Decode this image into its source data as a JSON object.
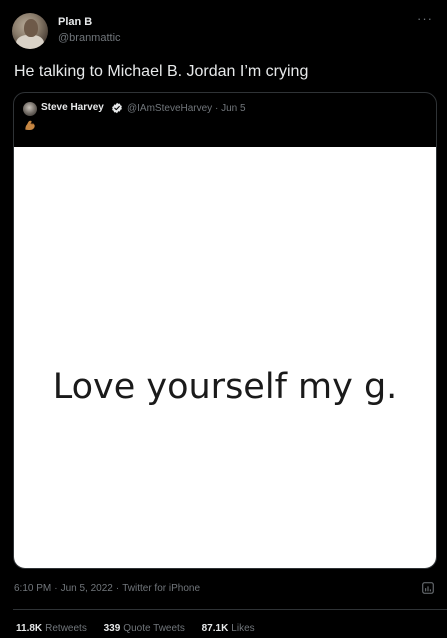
{
  "author": {
    "name": "Plan B",
    "handle": "@branmattic"
  },
  "tweet": {
    "text": "He talking to Michael B. Jordan I’m crying"
  },
  "quote": {
    "author_name": "Steve Harvey",
    "handle_and_date": "@IAmSteveHarvey · Jun 5",
    "image_text": "Love yourself my g."
  },
  "meta": {
    "time": "6:10 PM",
    "date": "Jun 5, 2022",
    "source": "Twitter for iPhone"
  },
  "stats": {
    "retweets": {
      "count": "11.8K",
      "label": "Retweets"
    },
    "quote_tweets": {
      "count": "339",
      "label": "Quote Tweets"
    },
    "likes": {
      "count": "87.1K",
      "label": "Likes"
    }
  },
  "colors": {
    "background": "#000000",
    "text_primary": "#e7e9ea",
    "text_secondary": "#71767b",
    "verified_badge": "#e7e9ea",
    "border": "#2f3336"
  },
  "icons": {
    "more": "more-horizontal-icon",
    "verified": "verified-badge-icon",
    "emoji": "flexed-biceps-emoji-icon",
    "analytics": "analytics-icon"
  }
}
